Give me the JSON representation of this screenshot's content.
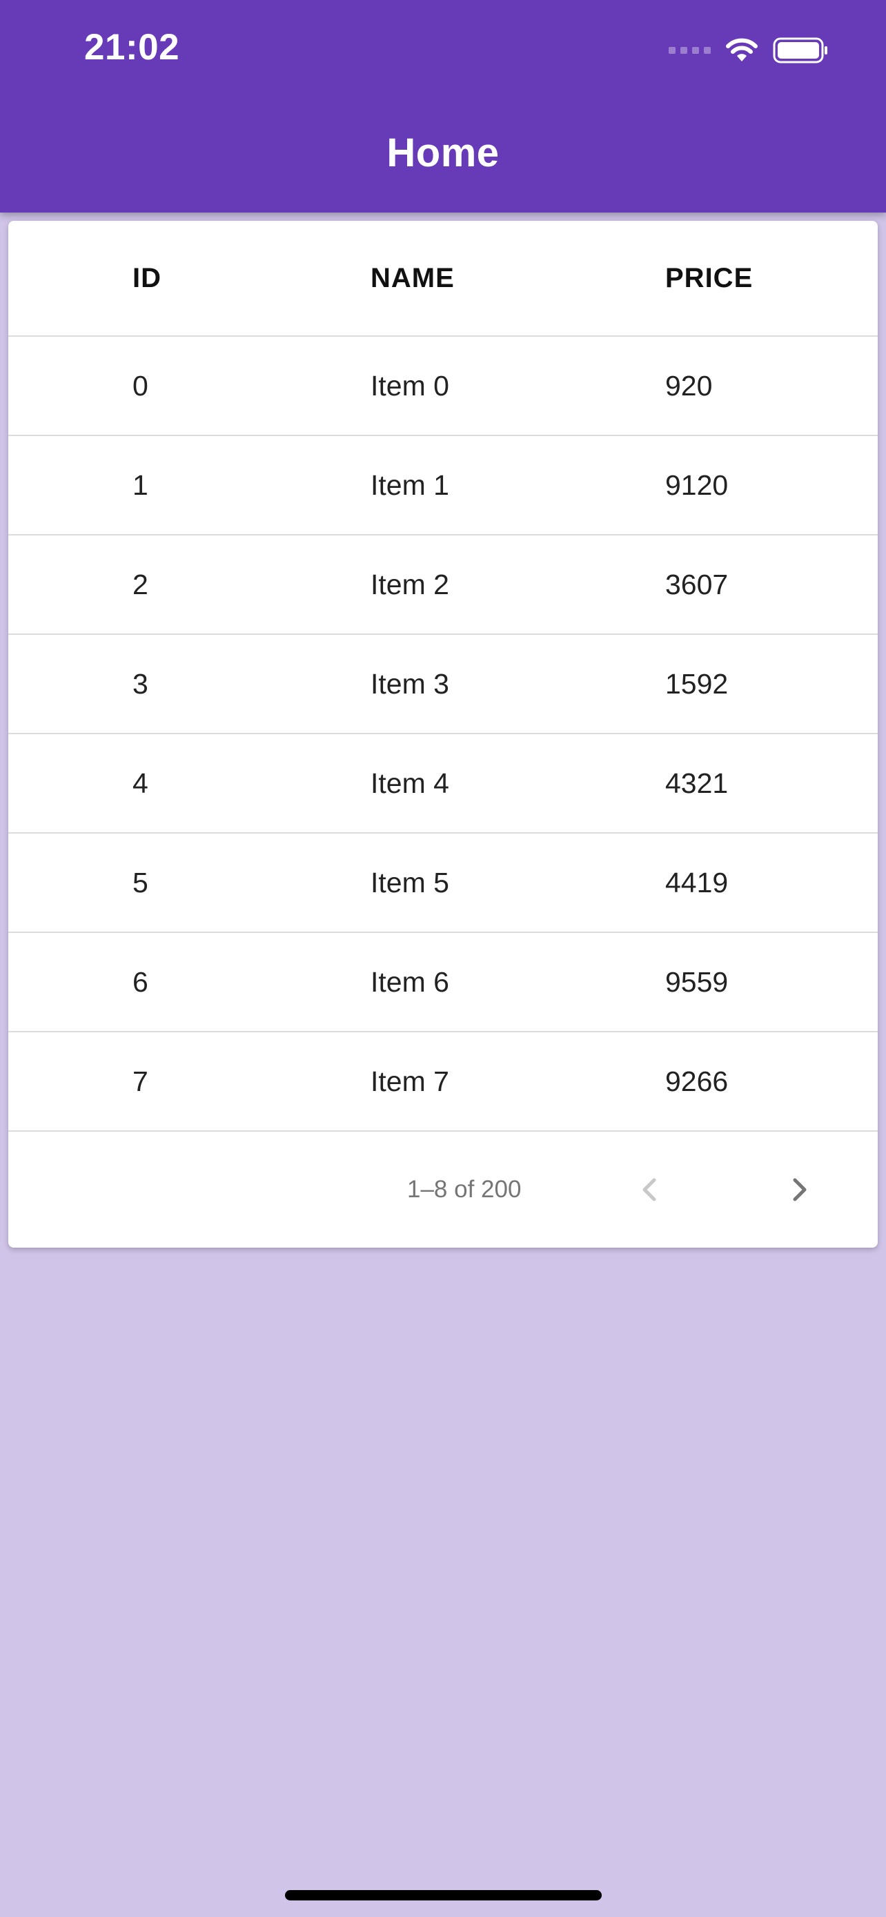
{
  "status_bar": {
    "time": "21:02",
    "icons": [
      "cellular-signal-icon",
      "wifi-icon",
      "battery-icon"
    ]
  },
  "app_bar": {
    "title": "Home",
    "color": "#673ab7"
  },
  "table": {
    "columns": [
      "ID",
      "NAME",
      "PRICE"
    ],
    "rows": [
      {
        "id": "0",
        "name": "Item 0",
        "price": "920"
      },
      {
        "id": "1",
        "name": "Item 1",
        "price": "9120"
      },
      {
        "id": "2",
        "name": "Item 2",
        "price": "3607"
      },
      {
        "id": "3",
        "name": "Item 3",
        "price": "1592"
      },
      {
        "id": "4",
        "name": "Item 4",
        "price": "4321"
      },
      {
        "id": "5",
        "name": "Item 5",
        "price": "4419"
      },
      {
        "id": "6",
        "name": "Item 6",
        "price": "9559"
      },
      {
        "id": "7",
        "name": "Item 7",
        "price": "9266"
      }
    ]
  },
  "pagination": {
    "range_label": "1–8 of 200",
    "prev_icon": "chevron-left-icon",
    "next_icon": "chevron-right-icon"
  },
  "background_color": "#d0c4e8"
}
